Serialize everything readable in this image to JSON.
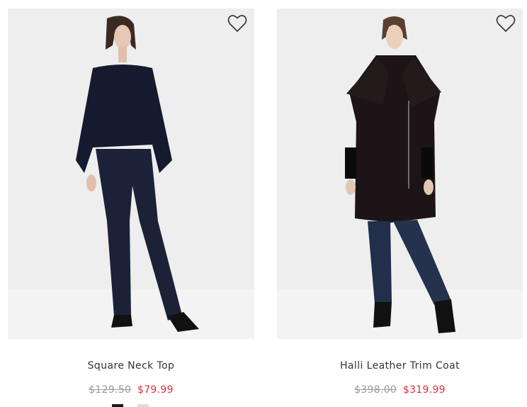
{
  "products": [
    {
      "name": "Square Neck Top",
      "price_was": "$129.50",
      "price_now": "$79.99",
      "wishlist_icon": "heart-outline-icon",
      "swatches": [
        "#1a1a1a",
        "#dddddd"
      ]
    },
    {
      "name": "Halli Leather Trim Coat",
      "price_was": "$398.00",
      "price_now": "$319.99",
      "wishlist_icon": "heart-outline-icon"
    }
  ],
  "colors": {
    "sale_price": "#d6323c",
    "original_price": "#9a9a9a",
    "product_name": "#333333",
    "photo_background": "#eeeeee"
  }
}
